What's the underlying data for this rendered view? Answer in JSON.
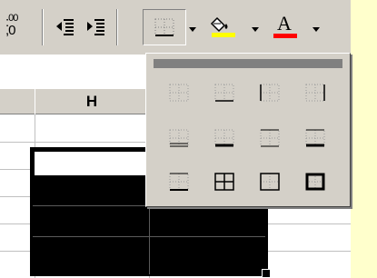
{
  "toolbar": {
    "number_format_label": ",00\n,0",
    "buttons": [
      {
        "name": "decrease-decimal-button",
        "icon": "decrease-decimal-icon"
      },
      {
        "name": "decrease-indent-button",
        "icon": "decrease-indent-icon"
      },
      {
        "name": "increase-indent-button",
        "icon": "increase-indent-icon"
      },
      {
        "name": "borders-button",
        "icon": "borders-icon"
      },
      {
        "name": "fill-color-button",
        "icon": "fill-color-icon"
      },
      {
        "name": "font-color-button",
        "icon": "font-color-icon"
      }
    ],
    "font_color_letter": "A",
    "fill_color": "#ffff00",
    "font_color": "#ff0000"
  },
  "sheet": {
    "column_header": "H"
  },
  "borders_palette": {
    "options": [
      "no-border",
      "bottom-border",
      "left-border",
      "right-border",
      "bottom-double-border",
      "thick-bottom-border",
      "top-bottom-border",
      "top-thick-bottom-border",
      "top-double-bottom-border",
      "all-borders",
      "outside-borders",
      "thick-box-border"
    ]
  },
  "colors": {
    "toolbar_bg": "#d4d0c8",
    "page_bg": "#ffffcc",
    "selection": "#000000"
  }
}
